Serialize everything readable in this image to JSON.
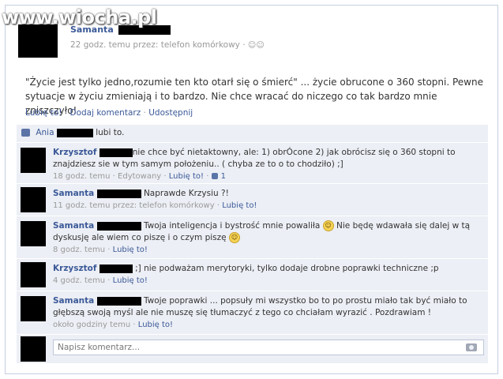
{
  "watermark": "www.wiocha.pl",
  "post": {
    "author": "Samanta",
    "meta": "22 godz. temu przez: telefon komórkowy · ",
    "text": "\"Życie jest tylko jedno,rozumie ten kto otarł się o śmierć\" ... życie obrucone o 360 stopni. Pewne sytuacje w życiu zmieniają i to bardzo. Nie chce wracać do niczego co tak bardzo mnie zniszczyło!",
    "actions": {
      "like": "Lubię to!",
      "comment": "Dodaj komentarz",
      "share": "Udostępnij",
      "sep": "·"
    },
    "likes": {
      "prefix": "Ania",
      "suffix": "lubi to."
    }
  },
  "comments": [
    {
      "author": "Krzysztof",
      "text": "nie chce być nietaktowny, ale: 1) obrÓcone 2) jak obrócisz się o 360 stopni to znajdziesz sie w tym samym położeniu.. ( chyba ze to o to chodziło) ;]",
      "time": "18 godz. temu",
      "extra": "Edytowany",
      "like": "Lubię to!",
      "likecount": "1"
    },
    {
      "author": "Samanta",
      "text": "Naprawde Krzysiu ?!",
      "time": "11 godz. temu przez: telefon komórkowy",
      "like": "Lubię to!"
    },
    {
      "author": "Samanta",
      "text1": "Twoja inteligencja i bystrość mnie powaliła",
      "text2": "Nie będę wdawała się dalej w tą dyskusję ale wiem co piszę i o czym piszę",
      "time": "8 godz. temu",
      "like": "Lubię to!"
    },
    {
      "author": "Krzysztof",
      "text": ";] nie podważam merytoryki, tylko dodaje drobne poprawki techniczne ;p",
      "time": "4 godz. temu",
      "like": "Lubię to!"
    },
    {
      "author": "Samanta",
      "text": "Twoje poprawki ... popsuły mi wszystko bo to po prostu miało tak być miało to głębszą swoją myśl ale nie muszę się tłumaczyć z tego co chciałam wyrazić . Pozdrawiam !",
      "time": "około godziny temu",
      "like": "Lubię to!"
    }
  ],
  "composer": {
    "placeholder": "Napisz komentarz..."
  }
}
